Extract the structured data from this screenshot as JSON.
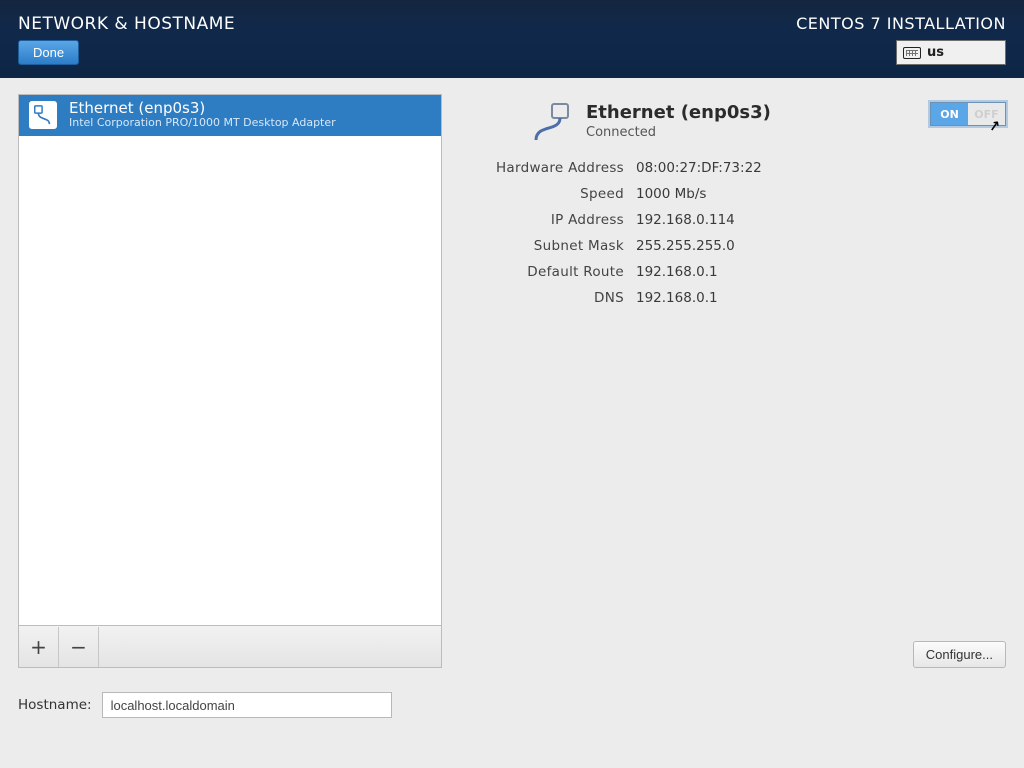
{
  "banner": {
    "title": "NETWORK & HOSTNAME",
    "install_title": "CENTOS 7 INSTALLATION",
    "done_label": "Done",
    "keyboard_layout": "us"
  },
  "interfaces": {
    "selected": 0,
    "items": [
      {
        "name": "Ethernet (enp0s3)",
        "desc": "Intel Corporation PRO/1000 MT Desktop Adapter"
      }
    ]
  },
  "list_toolbar": {
    "add": "+",
    "remove": "−"
  },
  "device": {
    "title": "Ethernet (enp0s3)",
    "status": "Connected",
    "toggle_on": "ON",
    "toggle_off": "OFF",
    "props": {
      "hw_label": "Hardware Address",
      "hw": "08:00:27:DF:73:22",
      "speed_label": "Speed",
      "speed": "1000 Mb/s",
      "ip_label": "IP Address",
      "ip": "192.168.0.114",
      "mask_label": "Subnet Mask",
      "mask": "255.255.255.0",
      "gw_label": "Default Route",
      "gw": "192.168.0.1",
      "dns_label": "DNS",
      "dns": "192.168.0.1"
    },
    "configure_label": "Configure..."
  },
  "hostname": {
    "label": "Hostname:",
    "value": "localhost.localdomain"
  }
}
